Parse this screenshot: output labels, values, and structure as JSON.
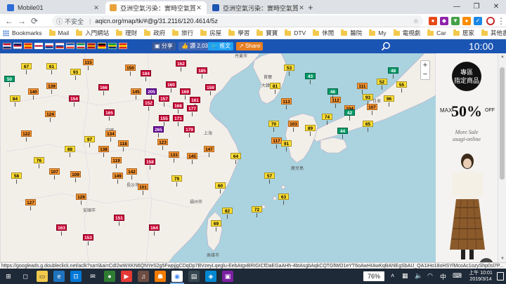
{
  "browser": {
    "tabs": [
      {
        "title": "Mobile01",
        "favicon_color": "#2e6bd6",
        "active": false
      },
      {
        "title": "亞洲空氣污染：實時空氣質量指數",
        "favicon_color": "#e8a33c",
        "active": true
      },
      {
        "title": "亞洲空氣污染：實時空氣質量指數",
        "favicon_color": "#1a55b4",
        "active": false
      }
    ],
    "new_tab_label": "+",
    "window_controls": [
      "—",
      "❐",
      "✕"
    ],
    "omnibox": {
      "security_label": "不安全",
      "url": "aqicn.org/map/tk/#@g/31.2116/120.4614/5z"
    },
    "bookmarks": [
      {
        "label": "Bookmarks",
        "type": "apps"
      },
      {
        "label": "Mail",
        "type": "folder"
      },
      {
        "label": "入門網站",
        "type": "folder"
      },
      {
        "label": "理財",
        "type": "folder"
      },
      {
        "label": "政府",
        "type": "folder"
      },
      {
        "label": "旅行",
        "type": "folder"
      },
      {
        "label": "房屋",
        "type": "folder"
      },
      {
        "label": "學習",
        "type": "folder"
      },
      {
        "label": "寶寶",
        "type": "folder"
      },
      {
        "label": "DTV",
        "type": "folder"
      },
      {
        "label": "休閒",
        "type": "folder"
      },
      {
        "label": "醫院",
        "type": "folder"
      },
      {
        "label": "My",
        "type": "folder"
      },
      {
        "label": "電視劇",
        "type": "folder"
      },
      {
        "label": "Car",
        "type": "folder"
      },
      {
        "label": "居家",
        "type": "folder"
      },
      {
        "label": "其他書籤",
        "type": "folder"
      }
    ]
  },
  "aqi_header": {
    "share_label": "分享",
    "like_label": "讚 2,033",
    "tweet_label": "推文",
    "share2_label": "Share",
    "clock": "10:00",
    "flags": [
      {
        "colors": [
          "#c8102e",
          "#ffffff",
          "#002868"
        ]
      },
      {
        "colors": [
          "#012169",
          "#c8102e",
          "#ffffff"
        ]
      },
      {
        "colors": [
          "#de2910",
          "#ffde00",
          "#de2910"
        ]
      },
      {
        "colors": [
          "#ffffff",
          "#bc002d",
          "#ffffff"
        ]
      },
      {
        "colors": [
          "#ffffff",
          "#cd2e3a",
          "#0047a0"
        ]
      },
      {
        "colors": [
          "#ffffff",
          "#0039a6",
          "#d52b1e"
        ]
      },
      {
        "colors": [
          "#0055a4",
          "#ffffff",
          "#ef4135"
        ]
      },
      {
        "colors": [
          "#009246",
          "#ffffff",
          "#ce2b37"
        ]
      },
      {
        "colors": [
          "#aa151b",
          "#f1bf00",
          "#aa151b"
        ]
      },
      {
        "colors": [
          "#000000",
          "#dd0000",
          "#ffce00"
        ]
      },
      {
        "colors": [
          "#009c3b",
          "#ffdf00",
          "#002776"
        ]
      },
      {
        "colors": [
          "#da251d",
          "#ffff00",
          "#da251d"
        ]
      }
    ]
  },
  "aqi_colors": {
    "good": "#009966",
    "moderate": "#ffde33",
    "sensitive": "#ff9933",
    "unhealthy": "#cc0033",
    "very_unhealthy": "#660099",
    "hazardous": "#7e0023"
  },
  "map_labels": [
    {
      "text": "丹東市",
      "color": "#555"
    },
    {
      "text": "首爾",
      "color": "#555"
    },
    {
      "text": "大韓民國",
      "color": "#555"
    },
    {
      "text": "日本",
      "color": "#555"
    },
    {
      "text": "鹿兒島",
      "color": "#555"
    },
    {
      "text": "上海",
      "color": "#555"
    },
    {
      "text": "中國",
      "color": "#555"
    },
    {
      "text": "高雄市",
      "color": "#555"
    },
    {
      "text": "福州市",
      "color": "#555"
    },
    {
      "text": "長沙市",
      "color": "#555"
    },
    {
      "text": "安順市",
      "color": "#555"
    }
  ],
  "markers": [
    {
      "v": "50",
      "c": "good"
    },
    {
      "v": "67",
      "c": "moderate"
    },
    {
      "v": "61",
      "c": "moderate"
    },
    {
      "v": "115",
      "c": "sensitive"
    },
    {
      "v": "139",
      "c": "sensitive"
    },
    {
      "v": "93",
      "c": "moderate"
    },
    {
      "v": "140",
      "c": "sensitive"
    },
    {
      "v": "84",
      "c": "moderate"
    },
    {
      "v": "154",
      "c": "unhealthy"
    },
    {
      "v": "166",
      "c": "unhealthy"
    },
    {
      "v": "165",
      "c": "unhealthy"
    },
    {
      "v": "145",
      "c": "sensitive"
    },
    {
      "v": "152",
      "c": "unhealthy"
    },
    {
      "v": "157",
      "c": "unhealthy"
    },
    {
      "v": "184",
      "c": "unhealthy"
    },
    {
      "v": "205",
      "c": "very_unhealthy"
    },
    {
      "v": "160",
      "c": "unhealthy"
    },
    {
      "v": "169",
      "c": "unhealthy"
    },
    {
      "v": "161",
      "c": "unhealthy"
    },
    {
      "v": "159",
      "c": "unhealthy"
    },
    {
      "v": "265",
      "c": "very_unhealthy"
    },
    {
      "v": "179",
      "c": "unhealthy"
    },
    {
      "v": "171",
      "c": "unhealthy"
    },
    {
      "v": "124",
      "c": "sensitive"
    },
    {
      "v": "122",
      "c": "sensitive"
    },
    {
      "v": "134",
      "c": "sensitive"
    },
    {
      "v": "118",
      "c": "sensitive"
    },
    {
      "v": "147",
      "c": "sensitive"
    },
    {
      "v": "145",
      "c": "sensitive"
    },
    {
      "v": "133",
      "c": "sensitive"
    },
    {
      "v": "123",
      "c": "sensitive"
    },
    {
      "v": "109",
      "c": "sensitive"
    },
    {
      "v": "107",
      "c": "sensitive"
    },
    {
      "v": "149",
      "c": "sensitive"
    },
    {
      "v": "127",
      "c": "sensitive"
    },
    {
      "v": "128",
      "c": "sensitive"
    },
    {
      "v": "163",
      "c": "unhealthy"
    },
    {
      "v": "164",
      "c": "unhealthy"
    },
    {
      "v": "153",
      "c": "unhealthy"
    },
    {
      "v": "151",
      "c": "unhealthy"
    },
    {
      "v": "43",
      "c": "good"
    },
    {
      "v": "53",
      "c": "moderate"
    },
    {
      "v": "113",
      "c": "sensitive"
    },
    {
      "v": "103",
      "c": "sensitive"
    },
    {
      "v": "81",
      "c": "moderate"
    },
    {
      "v": "91",
      "c": "moderate"
    },
    {
      "v": "70",
      "c": "moderate"
    },
    {
      "v": "74",
      "c": "moderate"
    },
    {
      "v": "89",
      "c": "moderate"
    },
    {
      "v": "112",
      "c": "sensitive"
    },
    {
      "v": "104",
      "c": "sensitive"
    },
    {
      "v": "93",
      "c": "moderate"
    },
    {
      "v": "44",
      "c": "good"
    },
    {
      "v": "42",
      "c": "good"
    },
    {
      "v": "107",
      "c": "sensitive"
    },
    {
      "v": "65",
      "c": "moderate"
    },
    {
      "v": "96",
      "c": "moderate"
    },
    {
      "v": "52",
      "c": "moderate"
    },
    {
      "v": "48",
      "c": "good"
    },
    {
      "v": "55",
      "c": "moderate"
    },
    {
      "v": "46",
      "c": "good"
    },
    {
      "v": "111",
      "c": "sensitive"
    },
    {
      "v": "117",
      "c": "sensitive"
    },
    {
      "v": "57",
      "c": "moderate"
    },
    {
      "v": "63",
      "c": "moderate"
    },
    {
      "v": "72",
      "c": "moderate"
    },
    {
      "v": "69",
      "c": "moderate"
    },
    {
      "v": "82",
      "c": "moderate"
    },
    {
      "v": "79",
      "c": "moderate"
    },
    {
      "v": "101",
      "c": "sensitive"
    },
    {
      "v": "119",
      "c": "sensitive"
    },
    {
      "v": "142",
      "c": "sensitive"
    },
    {
      "v": "158",
      "c": "unhealthy"
    },
    {
      "v": "155",
      "c": "unhealthy"
    },
    {
      "v": "168",
      "c": "unhealthy"
    },
    {
      "v": "177",
      "c": "unhealthy"
    },
    {
      "v": "185",
      "c": "unhealthy"
    },
    {
      "v": "162",
      "c": "unhealthy"
    },
    {
      "v": "150",
      "c": "sensitive"
    },
    {
      "v": "138",
      "c": "sensitive"
    },
    {
      "v": "97",
      "c": "moderate"
    },
    {
      "v": "88",
      "c": "moderate"
    },
    {
      "v": "76",
      "c": "moderate"
    },
    {
      "v": "58",
      "c": "moderate"
    },
    {
      "v": "60",
      "c": "moderate"
    },
    {
      "v": "64",
      "c": "moderate"
    }
  ],
  "ad": {
    "promo_line1": "專區",
    "promo_line2": "指定商品",
    "max_label": "MAX",
    "percent": "50%",
    "off_label": "OFF",
    "more_sale": "More Sale",
    "brand": "usagi-online",
    "colors": {
      "skirt": "#8b5a2b",
      "top": "#f5f0e6",
      "hair": "#3b2a1a"
    }
  },
  "status_url": "https://googleads.g.doubleclick.net/aclk?sa=l&ai=CdI2wWXKN6QNYeS2g5FwpjjgCDqDp7BVzeyLqeglu-EebAtgxBRIGICfDaEGaAHh-4btAsgbAqkCQTGfWO1eYT6oAwHIAwKqBAhlEgSbAU_QA1iHo18oHSYlMcoAc1ozyShp0sl7P...",
  "taskbar": {
    "battery": "76%",
    "ime_label": "中",
    "time": "上午 10:01",
    "date": "2019/3/14"
  }
}
